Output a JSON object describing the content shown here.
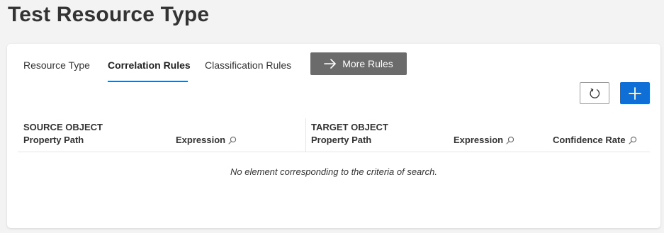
{
  "page": {
    "title": "Test Resource Type"
  },
  "tabs": [
    {
      "label": "Resource Type",
      "active": false
    },
    {
      "label": "Correlation Rules",
      "active": true
    },
    {
      "label": "Classification Rules",
      "active": false
    }
  ],
  "more_rules": {
    "label": "More Rules",
    "icon": "arrow-right-icon"
  },
  "toolbar": {
    "refresh_icon": "refresh-icon",
    "add_icon": "plus-icon",
    "add_color": "#0f6fd6"
  },
  "table": {
    "source_group": "SOURCE OBJECT",
    "target_group": "TARGET OBJECT",
    "columns": {
      "source_property_path": "Property Path",
      "source_expression": "Expression",
      "target_property_path": "Property Path",
      "target_expression": "Expression",
      "confidence_rate": "Confidence Rate"
    },
    "empty_message": "No element corresponding to the criteria of search."
  },
  "colors": {
    "accent": "#2374b6",
    "more_button_bg": "#6b6b6b",
    "page_bg": "#f3f3f3"
  }
}
